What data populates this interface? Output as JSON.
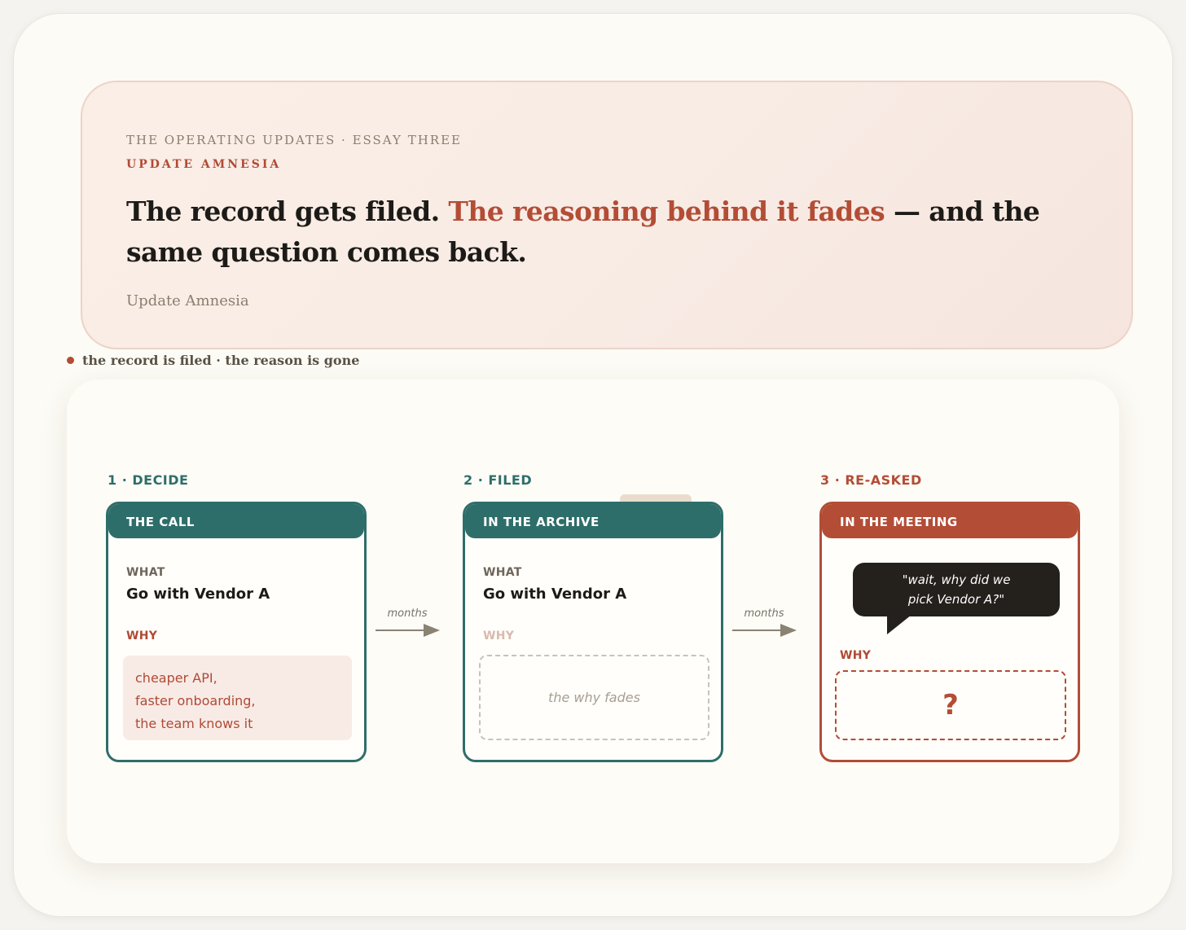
{
  "header": {
    "kicker": "THE OPERATING UPDATES · ESSAY THREE",
    "series": "UPDATE AMNESIA",
    "headline_start": "The record gets filed. ",
    "headline_accent": "The reasoning behind it fades",
    "headline_end": " — and the same question comes back.",
    "byline": "Update Amnesia"
  },
  "caption": "the record is filed · the reason is gone",
  "steps": [
    {
      "label": "1 · DECIDE",
      "box_title": "THE CALL",
      "what_label": "WHAT",
      "what_value": "Go with Vendor A",
      "why_label": "WHY",
      "why_lines": [
        "cheaper API,",
        "faster onboarding,",
        "the team knows it"
      ]
    },
    {
      "label": "2 · FILED",
      "box_title": "IN THE ARCHIVE",
      "what_label": "WHAT",
      "what_value": "Go with Vendor A",
      "why_label": "WHY",
      "why_placeholder": "the why fades"
    },
    {
      "label": "3 · RE-ASKED",
      "box_title": "IN THE MEETING",
      "quote_lines": [
        "\"wait, why did we",
        "pick Vendor A?\""
      ],
      "why_label": "WHY",
      "why_unknown": "?"
    }
  ],
  "arrows": [
    {
      "label": "months"
    },
    {
      "label": "months"
    }
  ],
  "colors": {
    "teal": "#2e6e6a",
    "rust": "#b34d36",
    "ink": "#1d1b17",
    "muted": "#8a7e6e"
  }
}
